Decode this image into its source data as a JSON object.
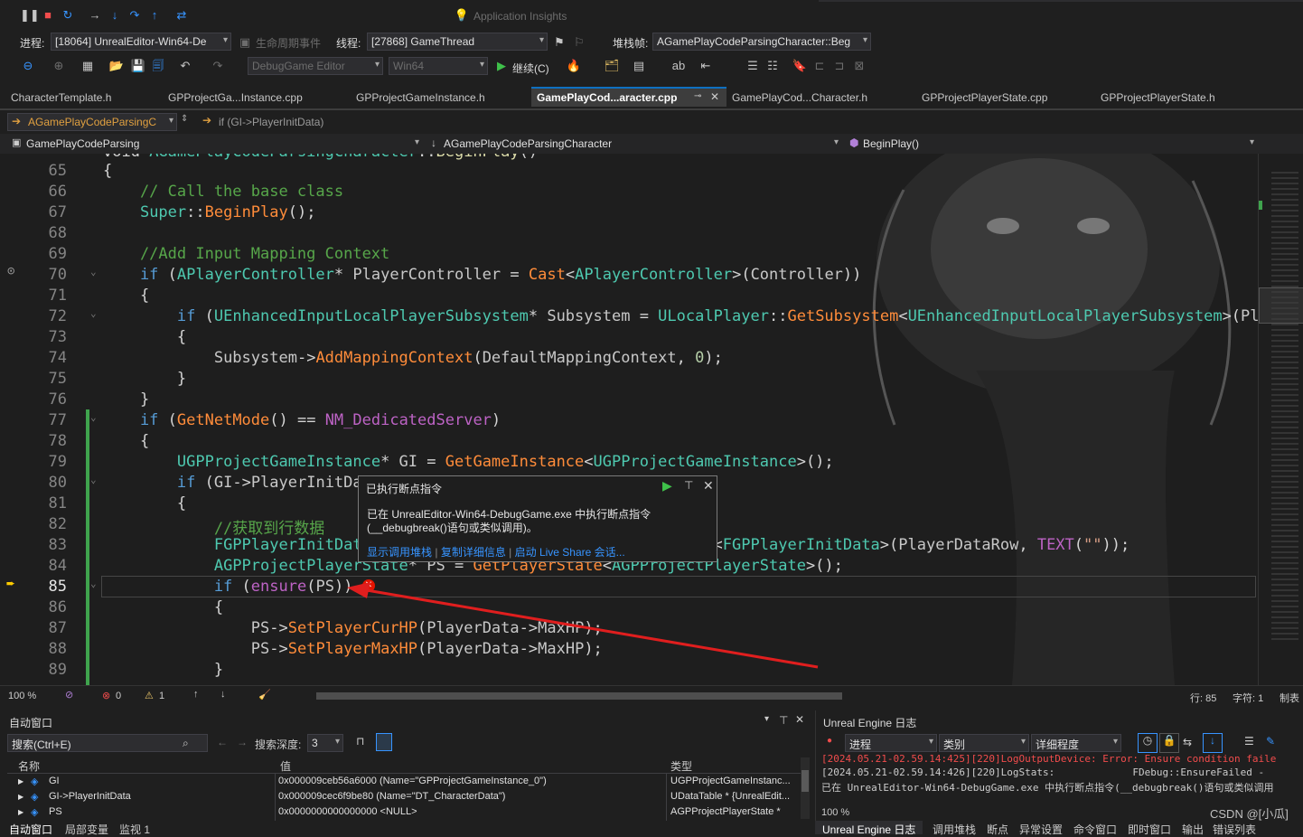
{
  "toolbar1": {
    "app_insights": "Application Insights"
  },
  "toolbar2": {
    "process_label": "进程:",
    "process_value": "[18064] UnrealEditor-Win64-De",
    "lifecycle_label": "生命周期事件",
    "thread_label": "线程:",
    "thread_value": "[27868] GameThread",
    "stackframe_label": "堆栈帧:",
    "stackframe_value": "AGamePlayCodeParsingCharacter::Beg"
  },
  "toolbar3": {
    "config_value": "DebugGame Editor",
    "platform_value": "Win64",
    "continue_label": "继续(C)"
  },
  "tabs": [
    {
      "label": "CharacterTemplate.h"
    },
    {
      "label": "GPProjectGa...Instance.cpp"
    },
    {
      "label": "GPProjectGameInstance.h"
    },
    {
      "label": "GamePlayCod...aracter.cpp"
    },
    {
      "label": "GamePlayCod...Character.h"
    },
    {
      "label": "GPProjectPlayerState.cpp"
    },
    {
      "label": "GPProjectPlayerState.h"
    }
  ],
  "nav": {
    "scope_value": "AGamePlayCodeParsingC",
    "breakpoint_text": "if (GI->PlayerInitData)",
    "project_value": "GamePlayCodeParsing",
    "class_value": "AGamePlayCodeParsingCharacter",
    "member_value": "BeginPlay()"
  },
  "popup": {
    "title": "已执行断点指令",
    "message_line1": "已在 UnrealEditor-Win64-DebugGame.exe 中执行断点指令",
    "message_line2": "(__debugbreak()语句或类似调用)。",
    "link1": "显示调用堆栈",
    "link2": "复制详细信息",
    "link3": "启动 Live Share 会话..."
  },
  "editor_status": {
    "zoom": "100 %",
    "errors": "0",
    "warnings": "1",
    "line": "行: 85",
    "col": "字符: 1",
    "tabs_mode": "制表"
  },
  "autos": {
    "title": "自动窗口",
    "search_placeholder": "搜索(Ctrl+E)",
    "depth_label": "搜索深度:",
    "depth_value": "3",
    "col_name": "名称",
    "col_value": "值",
    "col_type": "类型",
    "rows": [
      {
        "name": "GI",
        "value": "0x000009ceb56a6000 (Name=\"GPProjectGameInstance_0\")",
        "type": "UGPProjectGameInstanc..."
      },
      {
        "name": "GI->PlayerInitData",
        "value": "0x000009cec6f9be80 (Name=\"DT_CharacterData\")",
        "type": "UDataTable * {UnrealEdit..."
      },
      {
        "name": "PS",
        "value": "0x0000000000000000 <NULL>",
        "type": "AGPProjectPlayerState *"
      }
    ]
  },
  "bottom_tabs_left": [
    {
      "label": "自动窗口"
    },
    {
      "label": "局部变量"
    },
    {
      "label": "监视 1"
    }
  ],
  "ue_log": {
    "title": "Unreal Engine 日志",
    "filter1": "进程",
    "filter2": "类别",
    "filter3": "详细程度",
    "lines": [
      "[2024.05.21-02.59.14:425][220]LogOutputDevice: Error: Ensure condition faile",
      "[2024.05.21-02.59.14:426][220]LogStats:             FDebug::EnsureFailed -",
      "已在 UnrealEditor-Win64-DebugGame.exe 中执行断点指令(__debugbreak()语句或类似调用"
    ],
    "zoom": "100 %"
  },
  "bottom_tabs_right": [
    {
      "label": "Unreal Engine 日志"
    },
    {
      "label": "调用堆栈"
    },
    {
      "label": "断点"
    },
    {
      "label": "异常设置"
    },
    {
      "label": "命令窗口"
    },
    {
      "label": "即时窗口"
    },
    {
      "label": "输出"
    },
    {
      "label": "错误列表"
    }
  ],
  "watermark": "CSDN @[小瓜]",
  "colors": {
    "background": "#1f1f1f",
    "editor": "#1e1e1e",
    "accent": "#0e70c0",
    "keyword": "#569cd6",
    "type": "#4ec9b0",
    "function": "#ff8c3a",
    "comment": "#57a64a",
    "arrow": "#e01e1e"
  }
}
